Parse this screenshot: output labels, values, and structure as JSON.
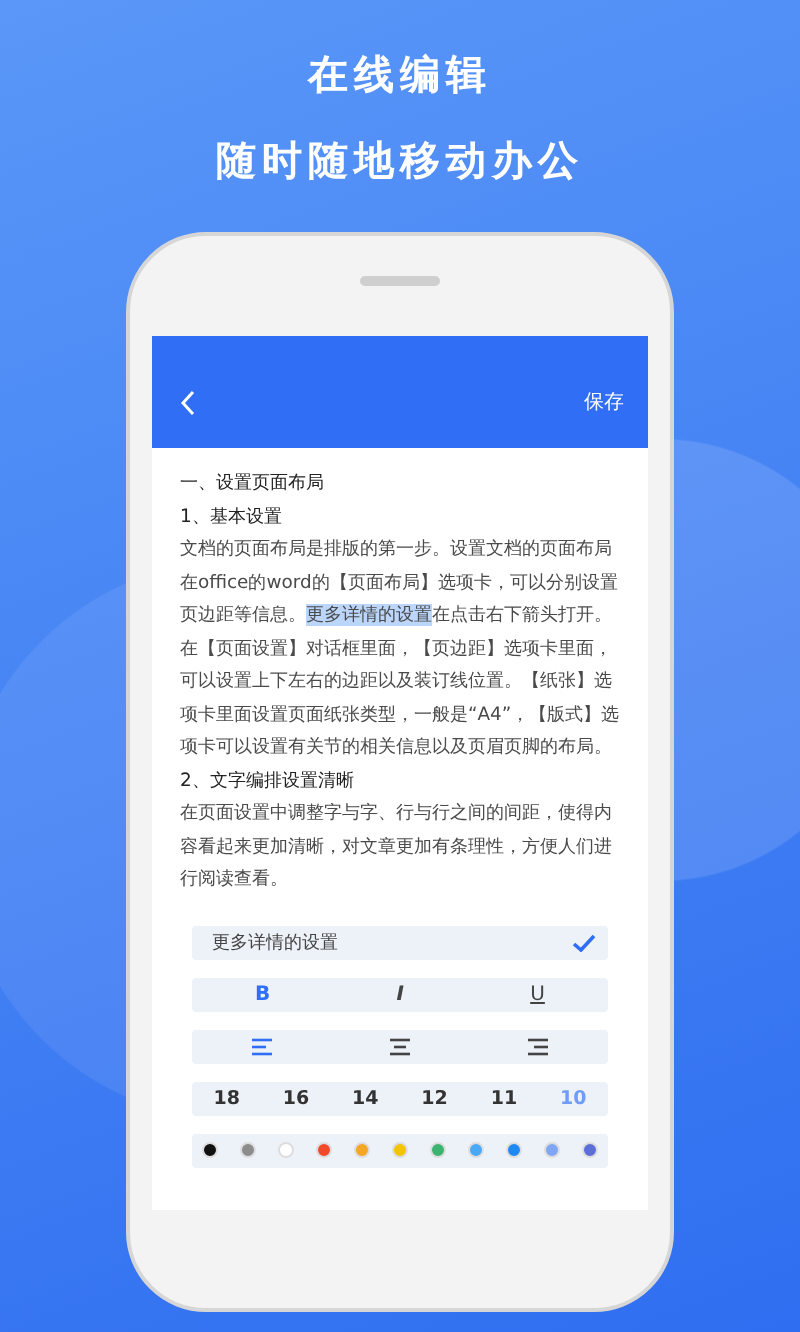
{
  "headline": [
    "在线编辑",
    "随时随地移动办公"
  ],
  "app_bar": {
    "action": "保存"
  },
  "document": [
    {
      "kind": "heading",
      "segments": [
        {
          "text": "一、设置页面布局",
          "highlighted": false
        }
      ]
    },
    {
      "kind": "heading",
      "segments": [
        {
          "text": "1、基本设置",
          "highlighted": false
        }
      ]
    },
    {
      "kind": "paragraph",
      "segments": [
        {
          "text": "文档的页面布局是排版的第一步。设置文档的页面布局在office的word的【页面布局】选项卡，可以分别设置页边距等信息。",
          "highlighted": false
        },
        {
          "text": "更多详情的设置",
          "highlighted": true
        },
        {
          "text": "在点击右下箭头打开。在【页面设置】对话框里面，【页边距】选项卡里面，可以设置上下左右的边距以及装订线位置。【纸张】选项卡里面设置页面纸张类型，一般是“A4”，【版式】选项卡可以设置有关节的相关信息以及页眉页脚的布局。",
          "highlighted": false
        }
      ]
    },
    {
      "kind": "heading",
      "segments": [
        {
          "text": "2、文字编排设置清晰",
          "highlighted": false
        }
      ]
    },
    {
      "kind": "paragraph",
      "segments": [
        {
          "text": "在页面设置中调整字与字、行与行之间的间距，使得内容看起来更加清晰，对文章更加有条理性，方便人们进行阅读查看。",
          "highlighted": false
        }
      ]
    }
  ],
  "option": {
    "label": "更多详情的设置",
    "checked": true
  },
  "text_styles": [
    {
      "kind": "bold",
      "label": "B",
      "selected": true
    },
    {
      "kind": "italic",
      "label": "I",
      "selected": false
    },
    {
      "kind": "underline",
      "label": "U",
      "selected": false
    }
  ],
  "alignments": [
    {
      "kind": "left",
      "selected": true
    },
    {
      "kind": "center",
      "selected": false
    },
    {
      "kind": "right",
      "selected": false
    }
  ],
  "font_sizes": [
    {
      "label": "18",
      "selected": false
    },
    {
      "label": "16",
      "selected": false
    },
    {
      "label": "14",
      "selected": false
    },
    {
      "label": "12",
      "selected": false
    },
    {
      "label": "11",
      "selected": false
    },
    {
      "label": "10",
      "selected": true
    }
  ],
  "colors": [
    {
      "color": "#111111"
    },
    {
      "color": "#8c8c8c"
    },
    {
      "color": "#ffffff"
    },
    {
      "color": "#f04a2a"
    },
    {
      "color": "#f5a623"
    },
    {
      "color": "#f5c400"
    },
    {
      "color": "#3cb371"
    },
    {
      "color": "#4aa8f5"
    },
    {
      "color": "#1e88f5"
    },
    {
      "color": "#7fa6f5"
    },
    {
      "color": "#5b6fd6"
    }
  ]
}
